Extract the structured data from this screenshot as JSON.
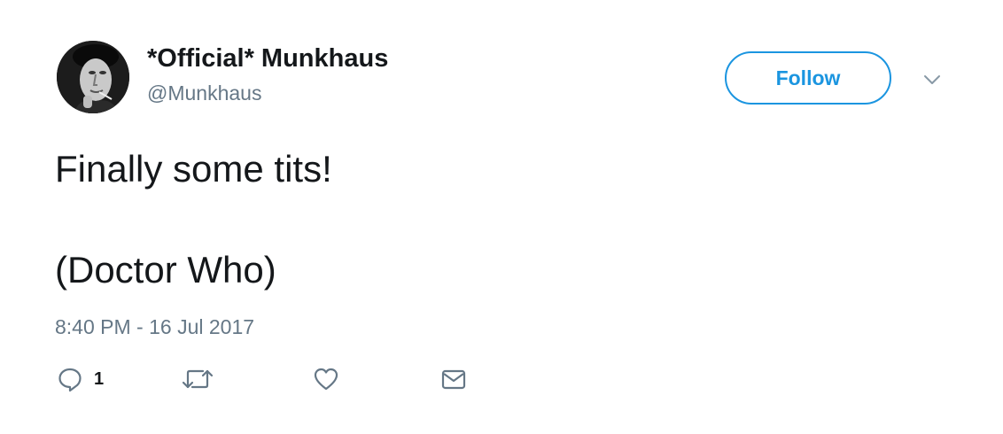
{
  "tweet": {
    "author": {
      "display_name": "*Official* Munkhaus",
      "handle": "@Munkhaus",
      "avatar_icon": "avatar-photo"
    },
    "follow_label": "Follow",
    "text_lines": [
      "Finally some tits!",
      "(Doctor Who)"
    ],
    "timestamp": "8:40 PM - 16 Jul 2017",
    "actions": {
      "reply_count": "1",
      "reply_icon": "reply-icon",
      "retweet_icon": "retweet-icon",
      "like_icon": "heart-icon",
      "dm_icon": "envelope-icon"
    }
  },
  "colors": {
    "accent": "#1b95e0",
    "text": "#14171a",
    "secondary": "#657786"
  }
}
